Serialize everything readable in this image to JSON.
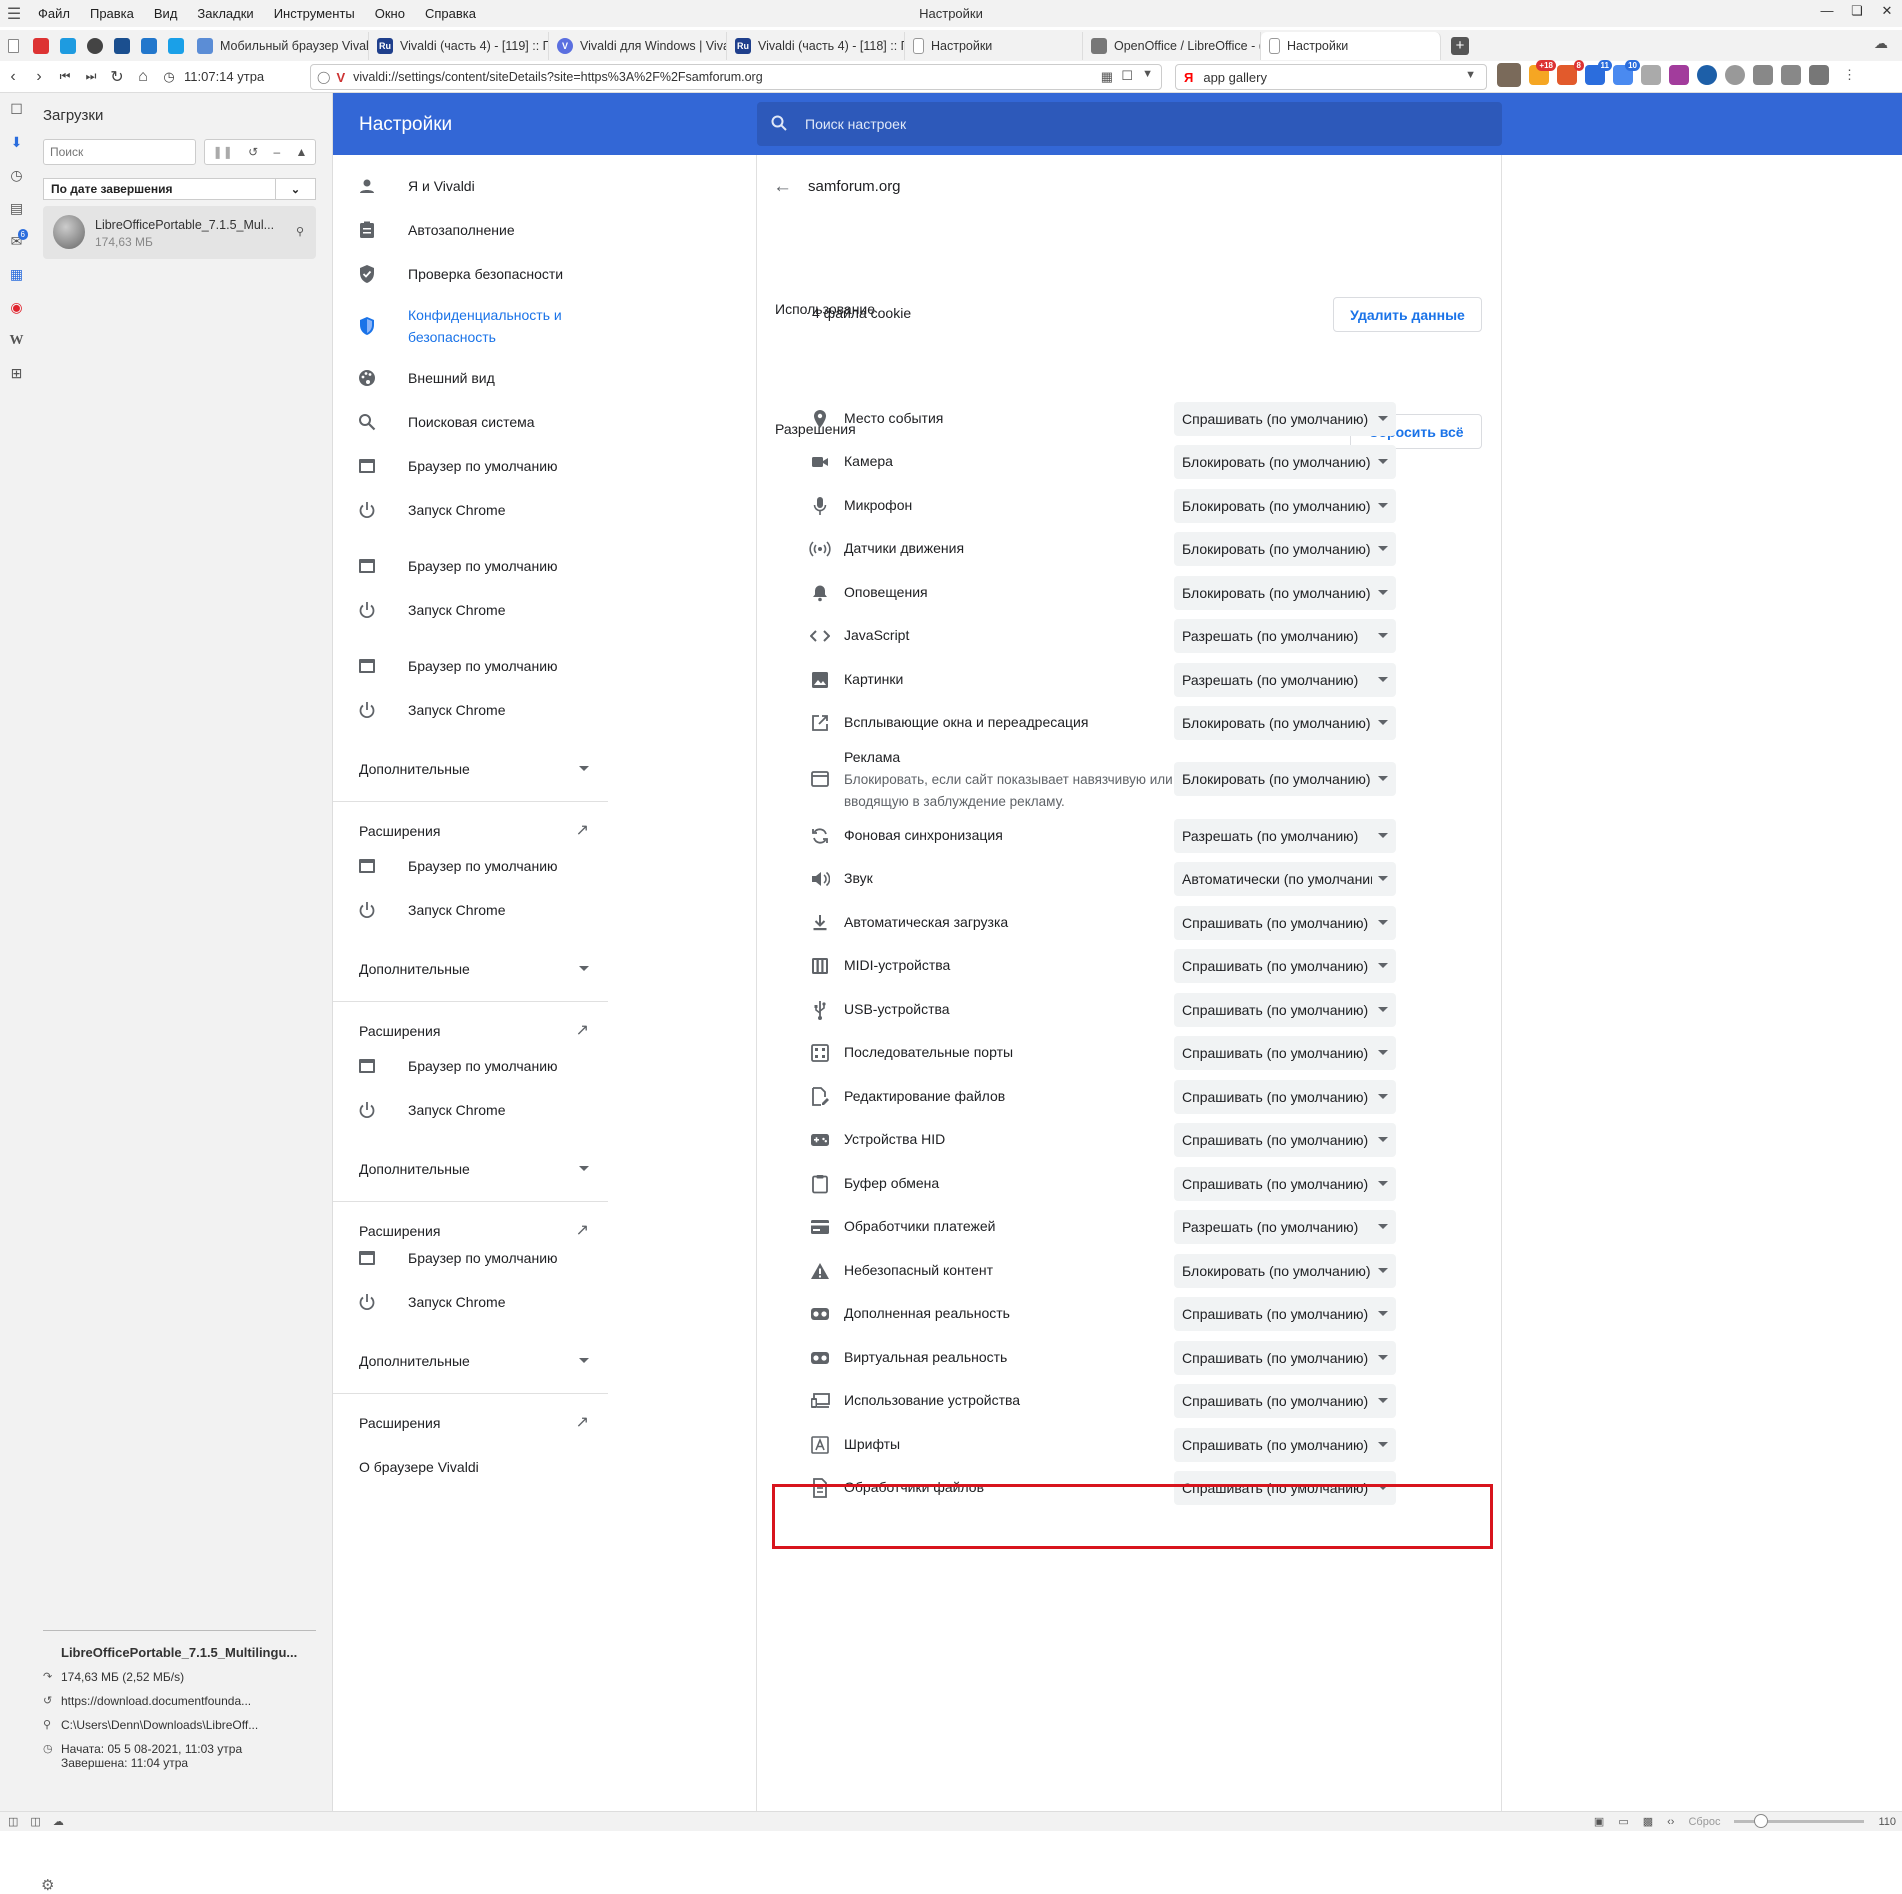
{
  "menubar": {
    "items": [
      "Файл",
      "Правка",
      "Вид",
      "Закладки",
      "Инструменты",
      "Окно",
      "Справка"
    ],
    "window_title": "Настройки"
  },
  "tabs": [
    {
      "label": "Мобильный браузер Vival",
      "fav_color": "#5b8dd6"
    },
    {
      "label": "Vivaldi (часть 4) - [119] :: П",
      "fav_color": "#1f3f8c",
      "fav_text": "Ru"
    },
    {
      "label": "Vivaldi для Windows | Vival",
      "fav_color": "#5b6fe0",
      "fav_text": "V"
    },
    {
      "label": "Vivaldi (часть 4) - [118] :: П",
      "fav_color": "#1f3f8c",
      "fav_text": "Ru"
    },
    {
      "label": "Настройки",
      "fav_color": "#bbbbbb"
    },
    {
      "label": "OpenOffice / LibreOffice - (",
      "fav_color": "#777777"
    },
    {
      "label": "Настройки",
      "fav_color": "#bbbbbb"
    }
  ],
  "address": {
    "time": "11:07:14 утра",
    "url": "vivaldi://settings/content/siteDetails?site=https%3A%2F%2Fsamforum.org",
    "vlogo": "V",
    "search_logo": "Я",
    "search_value": "app gallery"
  },
  "ext_badges": [
    "+18",
    "8",
    "11",
    "10"
  ],
  "side_badge": "6",
  "downloads": {
    "title": "Загрузки",
    "search_placeholder": "Поиск",
    "sort_label": "По дате завершения",
    "item_name": "LibreOfficePortable_7.1.5_Mul...",
    "item_size": "174,63 МБ",
    "detail_name": "LibreOfficePortable_7.1.5_Multilingu...",
    "detail_size": "174,63 МБ (2,52 МБ/s)",
    "detail_url": "https://download.documentfounda...",
    "detail_path": "C:\\Users\\Denn\\Downloads\\LibreOff...",
    "detail_started": "Начата: 05 5 08-2021, 11:03 утра",
    "detail_finished": "Завершена: 11:04 утра"
  },
  "statusbar": {
    "reset_label": "Сброс",
    "zoom": "110"
  },
  "settings": {
    "title": "Настройки",
    "search_placeholder": "Поиск настроек",
    "nav": {
      "me": "Я и Vivaldi",
      "autofill": "Автозаполнение",
      "safety": "Проверка безопасности",
      "privacy": "Конфиденциальность и безопасность",
      "appearance": "Внешний вид",
      "search_engine": "Поисковая система",
      "default_browser": "Браузер по умолчанию",
      "startup": "Запуск Chrome",
      "advanced": "Дополнительные",
      "extensions": "Расширения",
      "about": "О браузере Vivaldi"
    },
    "site": {
      "host": "samforum.org",
      "usage_title": "Использование",
      "cookies": "4 файла cookie",
      "clear_button": "Удалить данные",
      "perms_title": "Разрешения",
      "reset_button": "Сбросить всё"
    },
    "permissions": [
      {
        "label": "Место события",
        "value": "Спрашивать (по умолчанию)",
        "icon": "location-icon"
      },
      {
        "label": "Камера",
        "value": "Блокировать (по умолчанию)",
        "icon": "camera-icon"
      },
      {
        "label": "Микрофон",
        "value": "Блокировать (по умолчанию)",
        "icon": "microphone-icon"
      },
      {
        "label": "Датчики движения",
        "value": "Блокировать (по умолчанию)",
        "icon": "sensors-icon"
      },
      {
        "label": "Оповещения",
        "value": "Блокировать (по умолчанию)",
        "icon": "bell-icon"
      },
      {
        "label": "JavaScript",
        "value": "Разрешать (по умолчанию)",
        "icon": "code-icon"
      },
      {
        "label": "Картинки",
        "value": "Разрешать (по умолчанию)",
        "icon": "image-icon"
      },
      {
        "label": "Всплывающие окна и переадресация",
        "value": "Блокировать (по умолчанию)",
        "icon": "popup-icon"
      },
      {
        "label": "Реклама",
        "sub": "Блокировать, если сайт показывает навязчивую или вводящую в заблуждение рекламу.",
        "value": "Блокировать (по умолчанию)",
        "icon": "ads-icon"
      },
      {
        "label": "Фоновая синхронизация",
        "value": "Разрешать (по умолчанию)",
        "icon": "sync-icon"
      },
      {
        "label": "Звук",
        "value": "Автоматически (по умолчанию)",
        "icon": "sound-icon"
      },
      {
        "label": "Автоматическая загрузка",
        "value": "Спрашивать (по умолчанию)",
        "icon": "download-icon"
      },
      {
        "label": "MIDI-устройства",
        "value": "Спрашивать (по умолчанию)",
        "icon": "midi-icon"
      },
      {
        "label": "USB-устройства",
        "value": "Спрашивать (по умолчанию)",
        "icon": "usb-icon"
      },
      {
        "label": "Последовательные порты",
        "value": "Спрашивать (по умолчанию)",
        "icon": "serial-port-icon"
      },
      {
        "label": "Редактирование файлов",
        "value": "Спрашивать (по умолчанию)",
        "icon": "file-edit-icon"
      },
      {
        "label": "Устройства HID",
        "value": "Спрашивать (по умолчанию)",
        "icon": "gamepad-icon"
      },
      {
        "label": "Буфер обмена",
        "value": "Спрашивать (по умолчанию)",
        "icon": "clipboard-icon"
      },
      {
        "label": "Обработчики платежей",
        "value": "Разрешать (по умолчанию)",
        "icon": "card-icon"
      },
      {
        "label": "Небезопасный контент",
        "value": "Блокировать (по умолчанию)",
        "icon": "warning-icon"
      },
      {
        "label": "Дополненная реальность",
        "value": "Спрашивать (по умолчанию)",
        "icon": "vr-headset-icon"
      },
      {
        "label": "Виртуальная реальность",
        "value": "Спрашивать (по умолчанию)",
        "icon": "vr-headset-icon"
      },
      {
        "label": "Использование устройства",
        "value": "Спрашивать (по умолчанию)",
        "icon": "devices-icon"
      },
      {
        "label": "Шрифты",
        "value": "Спрашивать (по умолчанию)",
        "icon": "font-icon"
      },
      {
        "label": "Обработчики файлов",
        "value": "Спрашивать (по умолчанию)",
        "icon": "file-handler-icon"
      }
    ]
  }
}
